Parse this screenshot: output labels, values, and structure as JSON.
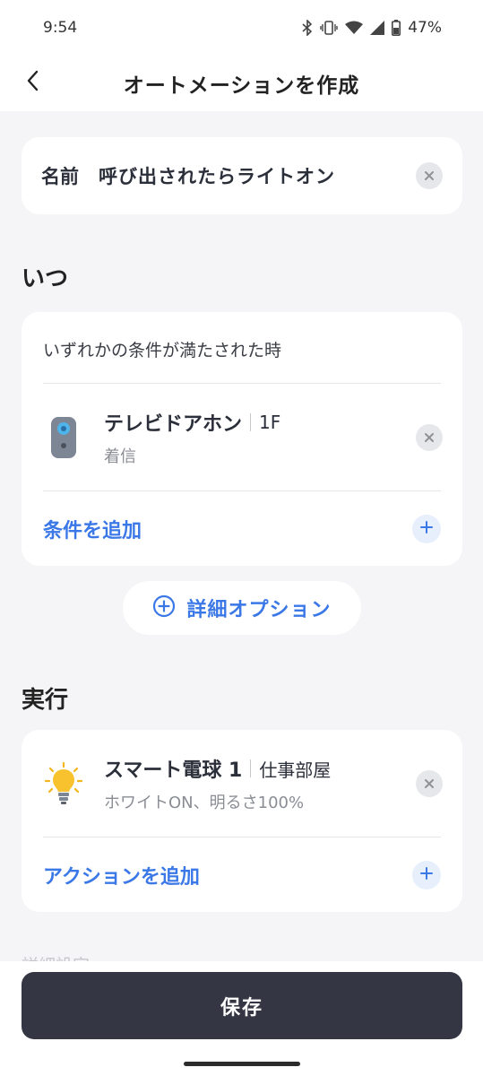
{
  "status_bar": {
    "time": "9:54",
    "battery": "47%",
    "icons": [
      "bluetooth-icon",
      "vibrate-icon",
      "wifi-icon",
      "signal-icon",
      "battery-icon"
    ]
  },
  "app_bar": {
    "title": "オートメーションを作成",
    "back_icon": "chevron-left-icon"
  },
  "name_card": {
    "label": "名前",
    "value": "呼び出されたらライトオン",
    "clear_icon": "clear-icon"
  },
  "when": {
    "title": "いつ",
    "condition_mode": "いずれかの条件が満たされた時",
    "device": {
      "name": "テレビドアホン",
      "room": "1F",
      "event": "着信",
      "icon": "doorbell-icon"
    },
    "add_label": "条件を追加"
  },
  "advanced": {
    "label": "詳細オプション",
    "icon": "plus-circle-icon"
  },
  "run": {
    "title": "実行",
    "device": {
      "name": "スマート電球 1",
      "room": "仕事部屋",
      "action": "ホワイトON、明るさ100%",
      "icon": "light-bulb-icon"
    },
    "add_label": "アクションを追加"
  },
  "footer": {
    "partial_text": "詳細設定",
    "save_label": "保存"
  },
  "colors": {
    "accent": "#3b78e7",
    "save_button": "#343743",
    "background": "#f5f5f7"
  }
}
